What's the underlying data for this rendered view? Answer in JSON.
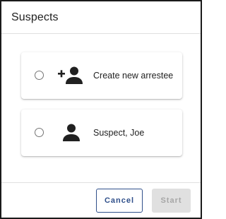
{
  "dialog": {
    "title": "Suspects"
  },
  "options": [
    {
      "label": "Create new arrestee",
      "icon": "person-add-icon",
      "selected": false
    },
    {
      "label": "Suspect, Joe",
      "icon": "person-icon",
      "selected": false
    }
  ],
  "actions": {
    "cancel_label": "Cancel",
    "start_label": "Start"
  },
  "colors": {
    "primary": "#2f4f8a",
    "disabled_bg": "#e0e0e0",
    "disabled_text": "#a6a6a6",
    "icon": "#212121"
  }
}
